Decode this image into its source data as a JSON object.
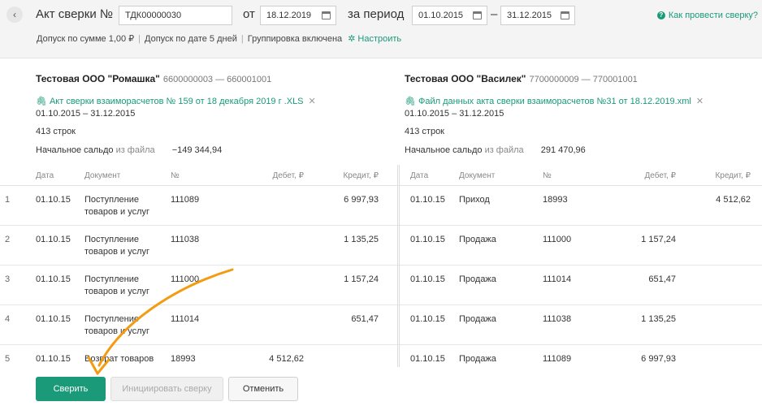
{
  "header": {
    "title": "Акт сверки №",
    "number_value": "ТДК00000030",
    "from_label": "от",
    "date_value": "18.12.2019",
    "period_label": "за период",
    "period_start": "01.10.2015",
    "period_dash": "–",
    "period_end": "31.12.2015",
    "help_link": "Как провести сверку?",
    "params": {
      "sum_tolerance": "Допуск по сумме 1,00 ₽",
      "date_tolerance": "Допуск по дате 5 дней",
      "grouping": "Группировка включена",
      "setup_link": "Настроить"
    }
  },
  "left_org": {
    "name": "Тестовая ООО \"Ромашка\"",
    "inn": "6600000003 — 660001001",
    "file": "Акт сверки взаиморасчетов № 159 от 18 декабря 2019 г .XLS",
    "period": "01.10.2015 – 31.12.2015",
    "rows_count": "413 строк",
    "saldo_label": "Начальное сальдо",
    "saldo_source": "из файла",
    "saldo_value": "−149 344,94"
  },
  "right_org": {
    "name": "Тестовая ООО \"Василек\"",
    "inn": "7700000009 — 770001001",
    "file": "Файл данных акта сверки взаиморасчетов №31 от 18.12.2019.xml",
    "period": "01.10.2015 – 31.12.2015",
    "rows_count": "413 строк",
    "saldo_label": "Начальное сальдо",
    "saldo_source": "из файла",
    "saldo_value": "291 470,96"
  },
  "columns": {
    "date": "Дата",
    "document": "Документ",
    "number": "№",
    "debit": "Дебет, ₽",
    "credit": "Кредит, ₽"
  },
  "rows": [
    {
      "idx": "1",
      "left": {
        "date": "01.10.15",
        "doc1": "Поступление",
        "doc2": "товаров и услуг",
        "num": "111089",
        "debit": "",
        "credit": "6 997,93"
      },
      "right": {
        "date": "01.10.15",
        "doc": "Приход",
        "num": "18993",
        "debit": "",
        "credit": "4 512,62"
      }
    },
    {
      "idx": "2",
      "left": {
        "date": "01.10.15",
        "doc1": "Поступление",
        "doc2": "товаров и услуг",
        "num": "111038",
        "debit": "",
        "credit": "1 135,25"
      },
      "right": {
        "date": "01.10.15",
        "doc": "Продажа",
        "num": "111000",
        "debit": "1 157,24",
        "credit": ""
      }
    },
    {
      "idx": "3",
      "left": {
        "date": "01.10.15",
        "doc1": "Поступление",
        "doc2": "товаров и услуг",
        "num": "111000",
        "debit": "",
        "credit": "1 157,24"
      },
      "right": {
        "date": "01.10.15",
        "doc": "Продажа",
        "num": "111014",
        "debit": "651,47",
        "credit": ""
      }
    },
    {
      "idx": "4",
      "left": {
        "date": "01.10.15",
        "doc1": "Поступление",
        "doc2": "товаров и услуг",
        "num": "111014",
        "debit": "",
        "credit": "651,47"
      },
      "right": {
        "date": "01.10.15",
        "doc": "Продажа",
        "num": "111038",
        "debit": "1 135,25",
        "credit": ""
      }
    },
    {
      "idx": "5",
      "left": {
        "date": "01.10.15",
        "doc1": "Возврат товаров",
        "doc2": "",
        "num": "18993",
        "debit": "4 512,62",
        "credit": ""
      },
      "right": {
        "date": "01.10.15",
        "doc": "Продажа",
        "num": "111089",
        "debit": "6 997,93",
        "credit": ""
      }
    }
  ],
  "footer": {
    "reconcile": "Сверить",
    "initiate": "Инициировать сверку",
    "cancel": "Отменить"
  },
  "colors": {
    "accent": "#1a9a78",
    "arrow": "#f39c12"
  }
}
